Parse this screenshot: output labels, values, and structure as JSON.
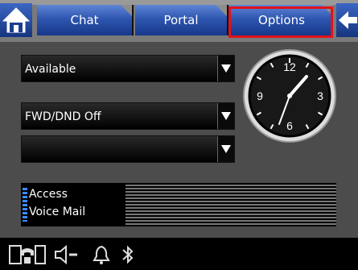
{
  "tabs": [
    {
      "label": "Chat"
    },
    {
      "label": "Portal"
    },
    {
      "label": "Options",
      "selected": true
    }
  ],
  "dropdowns": [
    {
      "value": "Available"
    },
    {
      "value": "FWD/DND Off"
    },
    {
      "value": ""
    }
  ],
  "clock": {
    "numerals": [
      "12",
      "3",
      "6",
      "9"
    ],
    "time": "1:08"
  },
  "voicemail": {
    "line1": "Access",
    "line2": "Voice Mail"
  },
  "bottom_icons": [
    "phone-icon",
    "speaker-icon",
    "bell-icon",
    "bluetooth-icon"
  ],
  "colors": {
    "tab_blue": "#2e56b0",
    "highlight_red": "#e0131b",
    "background": "#4c4c4c"
  }
}
